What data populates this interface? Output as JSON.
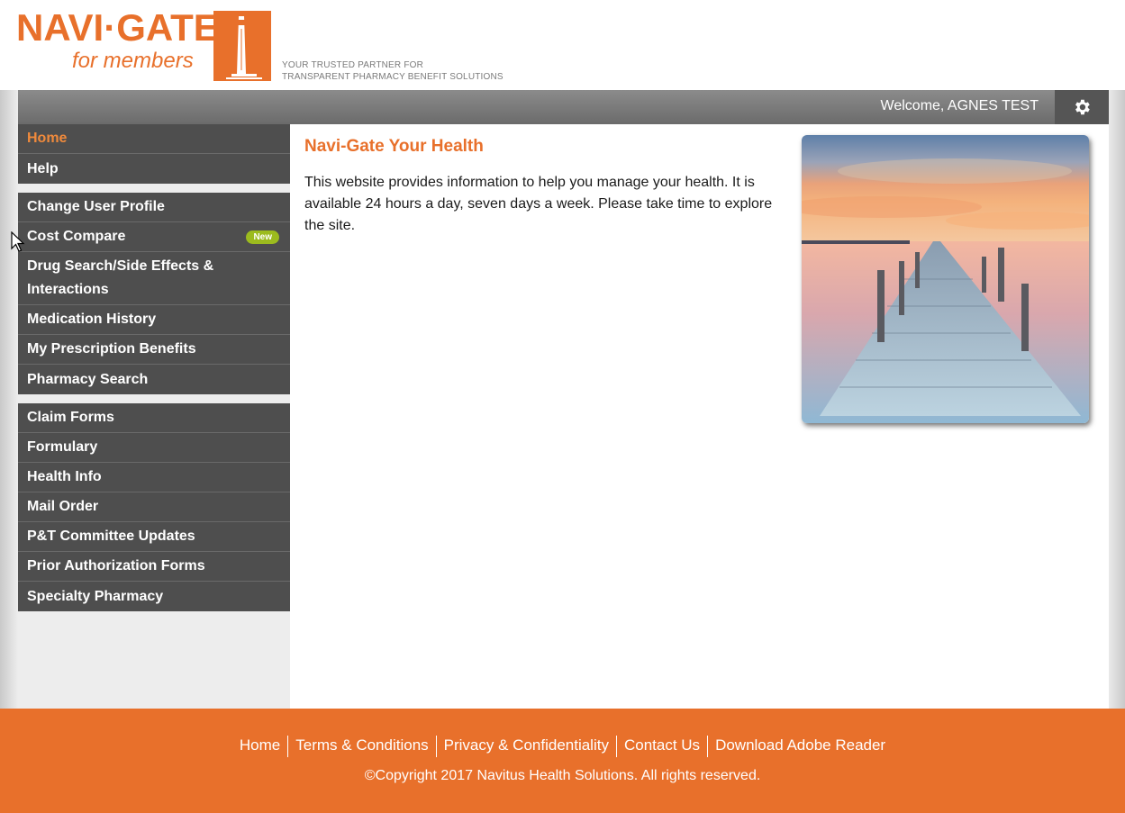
{
  "brand": {
    "logo_word": "NAVI·GATE",
    "logo_sub": "for members",
    "tagline_line1": "YOUR TRUSTED PARTNER FOR",
    "tagline_line2": "TRANSPARENT PHARMACY BENEFIT SOLUTIONS",
    "accent_color": "#e8702b"
  },
  "topbar": {
    "welcome": "Welcome,  AGNES TEST",
    "settings_icon": "gear-icon"
  },
  "sidebar": {
    "group1": [
      {
        "label": "Home",
        "active": true
      },
      {
        "label": "Help"
      }
    ],
    "group2": [
      {
        "label": "Change User Profile"
      },
      {
        "label": "Cost Compare",
        "badge": "New"
      },
      {
        "label": "Drug Search/Side Effects & Interactions"
      },
      {
        "label": "Medication History"
      },
      {
        "label": "My Prescription Benefits"
      },
      {
        "label": "Pharmacy Search"
      }
    ],
    "group3": [
      {
        "label": "Claim Forms"
      },
      {
        "label": "Formulary"
      },
      {
        "label": "Health Info"
      },
      {
        "label": "Mail Order"
      },
      {
        "label": "P&T Committee Updates"
      },
      {
        "label": "Prior Authorization Forms"
      },
      {
        "label": "Specialty Pharmacy"
      }
    ]
  },
  "main": {
    "title": "Navi-Gate Your Health",
    "body": "This website provides information to help you manage your health. It is available 24 hours a day, seven days a week. Please take time to explore the site."
  },
  "footer": {
    "links": [
      "Home",
      "Terms & Conditions",
      "Privacy & Confidentiality",
      "Contact Us",
      "Download Adobe Reader"
    ],
    "copyright": "©Copyright 2017 Navitus Health Solutions. All rights reserved."
  }
}
